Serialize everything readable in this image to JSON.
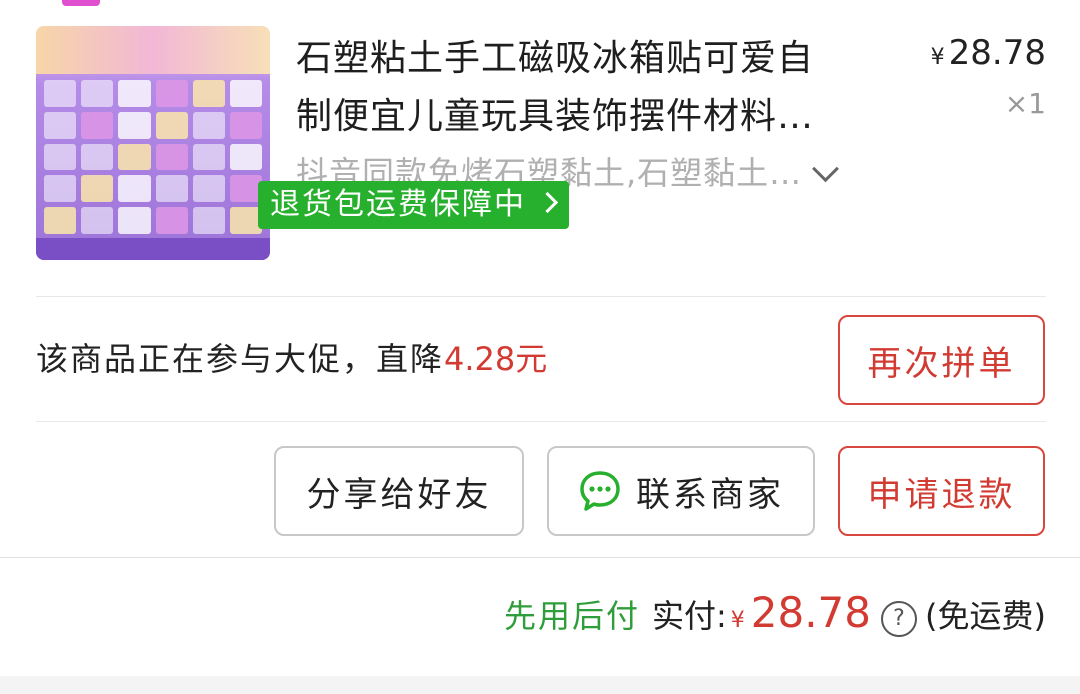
{
  "product": {
    "title_line1": "石塑粘土手工磁吸冰箱贴可爱自",
    "title_line2": "制便宜儿童玩具装饰摆件材料…",
    "price_currency": "¥",
    "price": "28.78",
    "quantity": "×1",
    "spec": "抖音同款免烤石塑黏土,石塑黏土…",
    "badge": "退货包运费保障中"
  },
  "promo": {
    "text": "该商品正在参与大促，直降",
    "amount": "4.28元"
  },
  "buttons": {
    "reorder": "再次拼单",
    "share": "分享给好友",
    "contact": "联系商家",
    "refund": "申请退款"
  },
  "total": {
    "pay_later": "先用后付",
    "label": "实付:",
    "currency": "¥",
    "amount": "28.78",
    "help": "?",
    "shipping": "(免运费)"
  },
  "colors": {
    "accent_red": "#d13b32",
    "badge_green": "#27b02d",
    "pay_later_green": "#2e9d3a"
  }
}
